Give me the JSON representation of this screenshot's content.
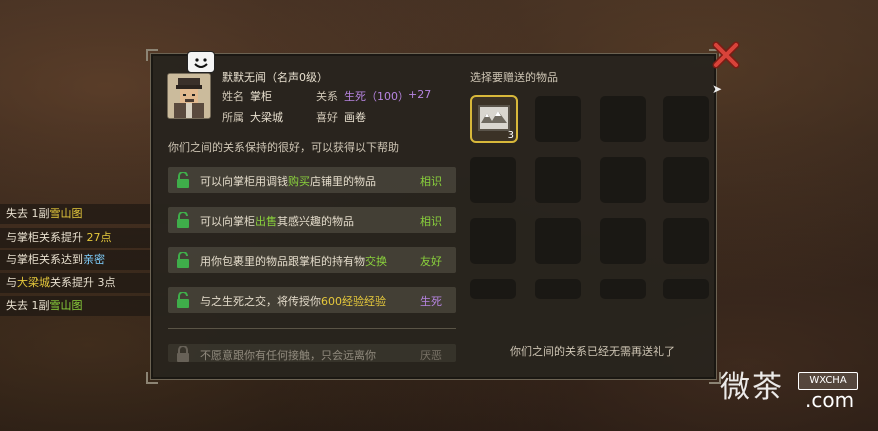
{
  "npc": {
    "name_title": "默默无闻（名声0级）",
    "name_label": "姓名",
    "name_value": "掌柜",
    "belong_label": "所属",
    "belong_value": "大梁城",
    "relation_label": "关系",
    "relation_value": "生死（100）",
    "relation_bonus": "+27",
    "hobby_label": "喜好",
    "hobby_value": "画卷",
    "relation_desc": "你们之间的关系保持的很好，可以获得以下帮助"
  },
  "benefits": [
    {
      "pre": "可以向掌柜用调钱",
      "hl": "购买",
      "post": "店铺里的物品",
      "tag": "相识"
    },
    {
      "pre": "可以向掌柜",
      "hl": "出售",
      "post": "其感兴趣的物品",
      "tag": "相识"
    },
    {
      "pre": "用你包裹里的物品跟掌柜的持有物",
      "hl": "交换",
      "post": "",
      "tag": "友好"
    },
    {
      "pre": "与之生死之交，将传授你",
      "hl": "600经验经验",
      "post": "",
      "tag": "生死"
    },
    {
      "pre": "不愿意跟你有任何接触，只会远离你",
      "hl": "",
      "post": "",
      "tag": "厌恶"
    }
  ],
  "gift": {
    "title": "选择要赠送的物品",
    "item_count": "3",
    "notice": "你们之间的关系已经无需再送礼了"
  },
  "log": [
    {
      "a": "失去 1副",
      "b": "雪山图",
      "c": ""
    },
    {
      "a": "与掌柜关系提升 ",
      "b": "27点",
      "c": ""
    },
    {
      "a": "与掌柜关系达到",
      "b": "亲密",
      "c": ""
    },
    {
      "a": "与",
      "b": "大梁城",
      "c": "关系提升 3点"
    },
    {
      "a": "失去 1副",
      "b": "雪山图",
      "c": ""
    }
  ],
  "watermark": {
    "text": "微茶",
    "badge": "WXCHA",
    "suffix": ".com"
  },
  "colors": {
    "accent_green": "#8ad23c",
    "accent_yellow": "#e6c93c",
    "relation_purple": "#b684e0",
    "close_red": "#d9433a"
  }
}
